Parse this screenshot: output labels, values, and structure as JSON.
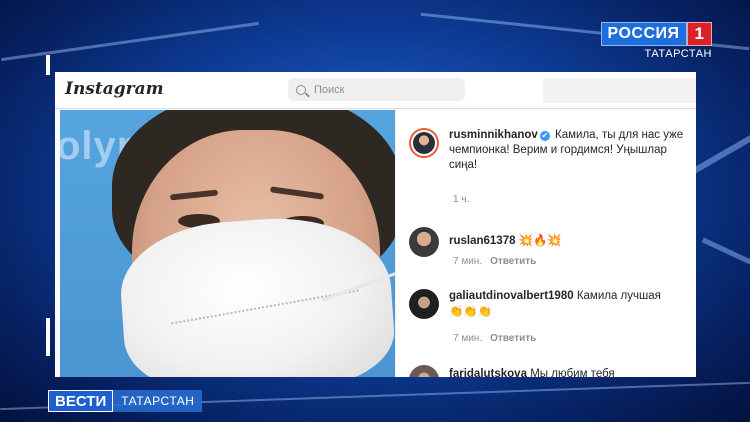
{
  "broadcast": {
    "channel_name": "РОССИЯ",
    "channel_number": "1",
    "channel_region": "ТАТАРСТАН",
    "news_name": "ВЕСТИ",
    "news_region": "ТАТАРСТАН"
  },
  "instagram": {
    "logo": "Instagram",
    "search_placeholder": "Поиск",
    "photo_bg_text": "olymp"
  },
  "post": {
    "author": "rusminnikhanov",
    "verified_mark": "✔",
    "caption": "Камила, ты для нас уже чемпионка! Верим и гордимся! Уңышлар сиңа!",
    "time": "1 ч."
  },
  "comments": [
    {
      "user": "ruslan61378",
      "text": "💥🔥💥",
      "time": "7 мин.",
      "reply_label": "Ответить"
    },
    {
      "user": "galiautdinovalbert1980",
      "text": "Камила лучшая",
      "text2": "👏👏👏",
      "time": "7 мин.",
      "reply_label": "Ответить"
    },
    {
      "user": "faridalutskova",
      "text": "Мы любим тебя"
    }
  ],
  "colors": {
    "accent_blue": "#1e6ee0",
    "accent_red": "#d8232a",
    "verified_blue": "#3897f0"
  }
}
